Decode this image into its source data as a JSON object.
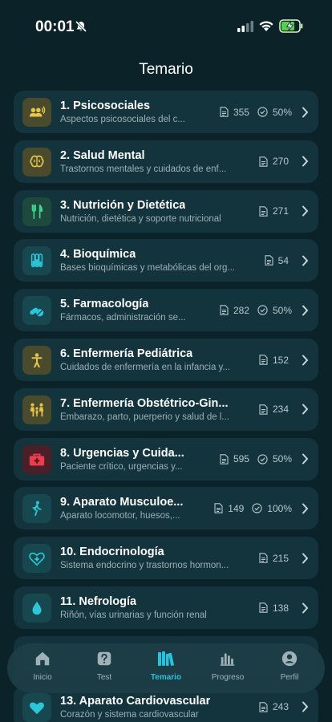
{
  "status_bar": {
    "time": "00:01"
  },
  "header": {
    "title": "Temario"
  },
  "colors": {
    "accent": "#27c3de",
    "background": "#0b2229",
    "card": "#13343c"
  },
  "topics": [
    {
      "title": "1. Psicosociales",
      "subtitle": "Aspectos psicosociales del c...",
      "count": "355",
      "progress": "50%",
      "icon": "people-speaking-icon",
      "icon_bg": "#4a4a2c",
      "icon_color": "#e8c44d"
    },
    {
      "title": "2. Salud Mental",
      "subtitle": "Trastornos mentales y cuidados de enf...",
      "count": "270",
      "progress": null,
      "icon": "brain-icon",
      "icon_bg": "#4a4a2c",
      "icon_color": "#e8c44d"
    },
    {
      "title": "3. Nutrición y Dietética",
      "subtitle": "Nutrición, dietética y soporte nutricional",
      "count": "271",
      "progress": null,
      "icon": "fork-knife-icon",
      "icon_bg": "#1d4a3c",
      "icon_color": "#3ed68f"
    },
    {
      "title": "4. Bioquímica",
      "subtitle": "Bases bioquímicas y metabólicas del org...",
      "count": "54",
      "progress": null,
      "icon": "test-tubes-icon",
      "icon_bg": "#17474f",
      "icon_color": "#2cc6d8"
    },
    {
      "title": "5. Farmacología",
      "subtitle": "Fármacos, administración se...",
      "count": "282",
      "progress": "50%",
      "icon": "pills-icon",
      "icon_bg": "#17474f",
      "icon_color": "#2cc6d8"
    },
    {
      "title": "6. Enfermería Pediátrica",
      "subtitle": "Cuidados de enfermería en la infancia y...",
      "count": "152",
      "progress": null,
      "icon": "child-icon",
      "icon_bg": "#4a4a2c",
      "icon_color": "#e8c44d"
    },
    {
      "title": "7. Enfermería Obstétrico-Gin...",
      "subtitle": "Embarazo, parto, puerperio y salud de l...",
      "count": "234",
      "progress": null,
      "icon": "family-icon",
      "icon_bg": "#4a4a2c",
      "icon_color": "#e8c44d"
    },
    {
      "title": "8. Urgencias y Cuida...",
      "subtitle": "Paciente crítico, urgencias y...",
      "count": "595",
      "progress": "50%",
      "icon": "medical-kit-icon",
      "icon_bg": "#4a1f28",
      "icon_color": "#ef3b4e"
    },
    {
      "title": "9. Aparato Musculoe...",
      "subtitle": "Aparato locomotor, huesos,...",
      "count": "149",
      "progress": "100%",
      "icon": "walking-person-icon",
      "icon_bg": "#17474f",
      "icon_color": "#2cc6d8"
    },
    {
      "title": "10. Endocrinología",
      "subtitle": "Sistema endocrino y trastornos hormon...",
      "count": "215",
      "progress": null,
      "icon": "heart-plus-icon",
      "icon_bg": "#17474f",
      "icon_color": "#2cc6d8"
    },
    {
      "title": "11. Nefrología",
      "subtitle": "Riñón, vías urinarias y función renal",
      "count": "138",
      "progress": null,
      "icon": "water-drop-icon",
      "icon_bg": "#17474f",
      "icon_color": "#2cc6d8"
    },
    {
      "title": "",
      "subtitle": "",
      "count": "",
      "progress": null,
      "icon": "",
      "icon_bg": "#17474f",
      "icon_color": "#2cc6d8"
    },
    {
      "title": "13. Aparato Cardiovascular",
      "subtitle": "Corazón y sistema cardiovascular",
      "count": "243",
      "progress": null,
      "icon": "heart-icon",
      "icon_bg": "#17474f",
      "icon_color": "#2cc6d8"
    }
  ],
  "tabbar": {
    "items": [
      {
        "label": "Inicio",
        "icon": "home-icon",
        "active": false
      },
      {
        "label": "Test",
        "icon": "question-icon",
        "active": false
      },
      {
        "label": "Temario",
        "icon": "books-icon",
        "active": true
      },
      {
        "label": "Progreso",
        "icon": "bar-chart-icon",
        "active": false
      },
      {
        "label": "Perfil",
        "icon": "profile-icon",
        "active": false
      }
    ]
  }
}
